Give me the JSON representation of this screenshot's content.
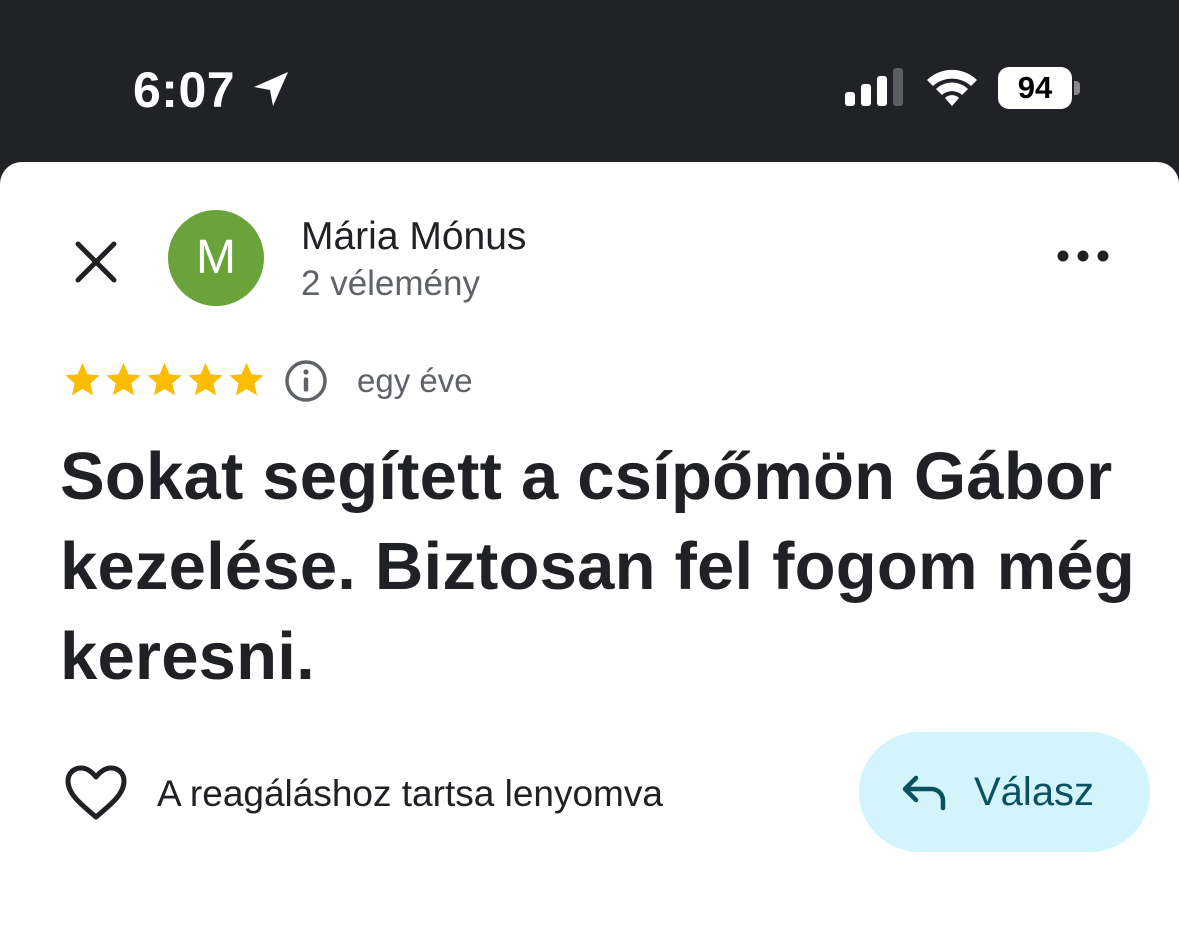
{
  "status_bar": {
    "time": "6:07",
    "battery": "94",
    "icons": [
      "location-arrow-icon",
      "cellular-signal-icon",
      "wifi-icon",
      "battery-icon"
    ]
  },
  "review": {
    "reviewer_name": "Mária Mónus",
    "avatar_letter": "M",
    "review_count": "2 vélemény",
    "rating": 5,
    "max_rating": 5,
    "date": "egy éve",
    "text": "Sokat segített a csípőmön Gábor kezelése. Biztosan fel fogom még keresni."
  },
  "actions": {
    "react_hint": "A reagáláshoz tartsa lenyomva",
    "reply_label": "Válasz"
  },
  "colors": {
    "status_bar_bg": "#212226",
    "avatar_bg": "#6aa33a",
    "star": "#fbbc04",
    "reply_button_bg": "#d3f4fb",
    "reply_text": "#0a5160"
  }
}
